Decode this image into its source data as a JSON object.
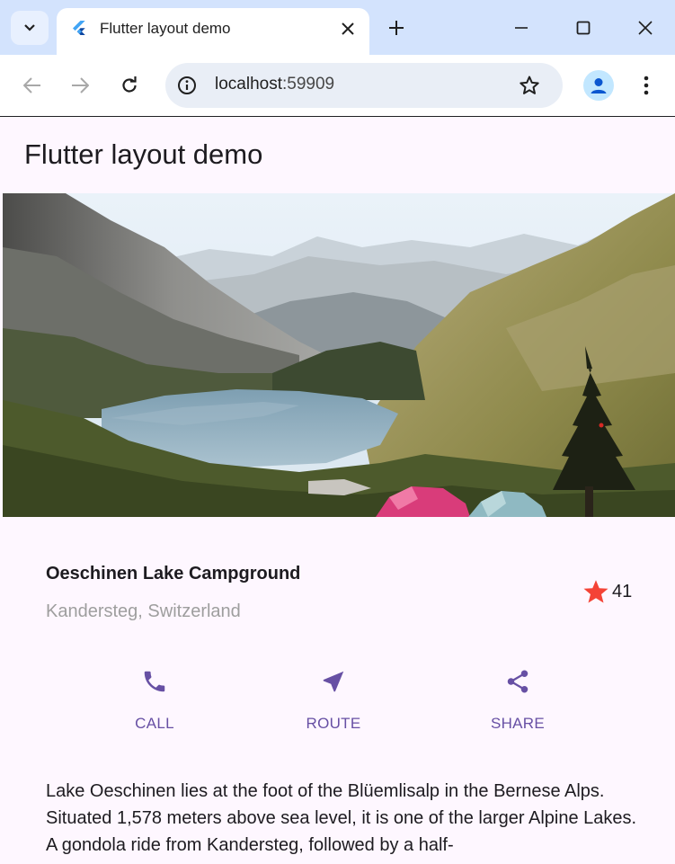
{
  "browser": {
    "tab": {
      "title": "Flutter layout demo"
    },
    "omnibox": {
      "host": "localhost",
      "port": ":59909"
    }
  },
  "app": {
    "appbar_title": "Flutter layout demo",
    "place": {
      "name": "Oeschinen Lake Campground",
      "location": "Kandersteg, Switzerland",
      "favorite_count": "41"
    },
    "actions": [
      {
        "label": "CALL",
        "icon": "phone-icon"
      },
      {
        "label": "ROUTE",
        "icon": "near-me-icon"
      },
      {
        "label": "SHARE",
        "icon": "share-icon"
      }
    ],
    "description": "Lake Oeschinen lies at the foot of the Blüemlisalp in the Bernese Alps. Situated 1,578 meters above sea level, it is one of the larger Alpine Lakes. A gondola ride from Kandersteg, followed by a half-"
  },
  "colors": {
    "primary": "#6750a4",
    "star": "#f44336",
    "background": "#fef7ff",
    "tabstrip": "#d3e3fd"
  }
}
